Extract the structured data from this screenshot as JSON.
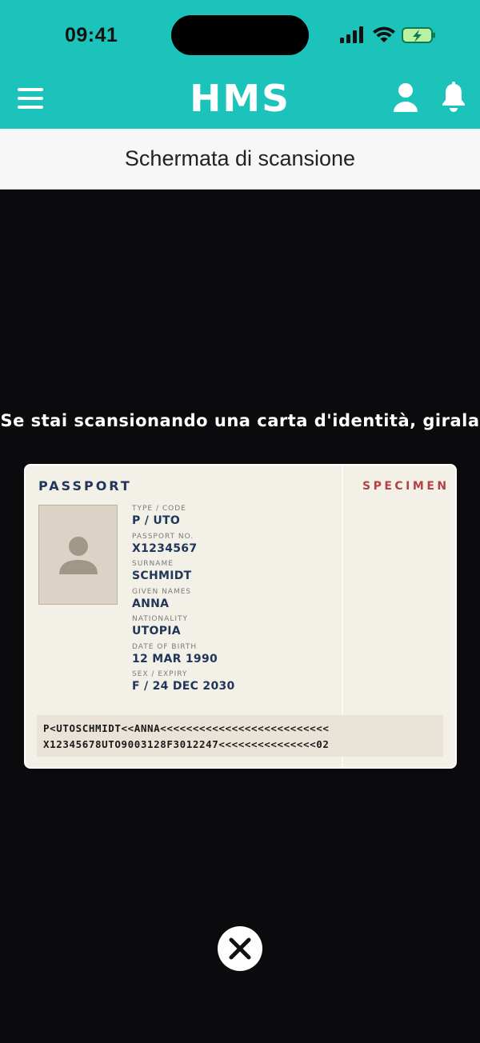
{
  "status_bar": {
    "time": "09:41"
  },
  "header": {
    "logo": "HMS",
    "icons": [
      "menu-icon",
      "user-icon",
      "bell-icon"
    ]
  },
  "subheader": {
    "title": "Schermata di scansione"
  },
  "instruction": "Se stai scansionando una carta d'identità, girala",
  "passport": {
    "title": "PASSPORT",
    "watermark": "SPECIMEN",
    "fields": [
      {
        "label": "TYPE / CODE",
        "value": "P / UTO"
      },
      {
        "label": "PASSPORT NO.",
        "value": "X1234567"
      },
      {
        "label": "SURNAME",
        "value": "SCHMIDT"
      },
      {
        "label": "GIVEN NAMES",
        "value": "ANNA"
      },
      {
        "label": "NATIONALITY",
        "value": "UTOPIA"
      },
      {
        "label": "DATE OF BIRTH",
        "value": "12 MAR 1990"
      },
      {
        "label": "SEX / EXPIRY",
        "value": "F / 24 DEC 2030"
      }
    ],
    "mrz": [
      "P<UTOSCHMIDT<<ANNA<<<<<<<<<<<<<<<<<<<<<<<<<<",
      "X12345678UTO9003128F3012247<<<<<<<<<<<<<<<02"
    ]
  },
  "colors": {
    "header": "#1cc3bb",
    "background": "#0b0b0d",
    "passport_text": "#1f3559",
    "specimen": "#b04444"
  }
}
